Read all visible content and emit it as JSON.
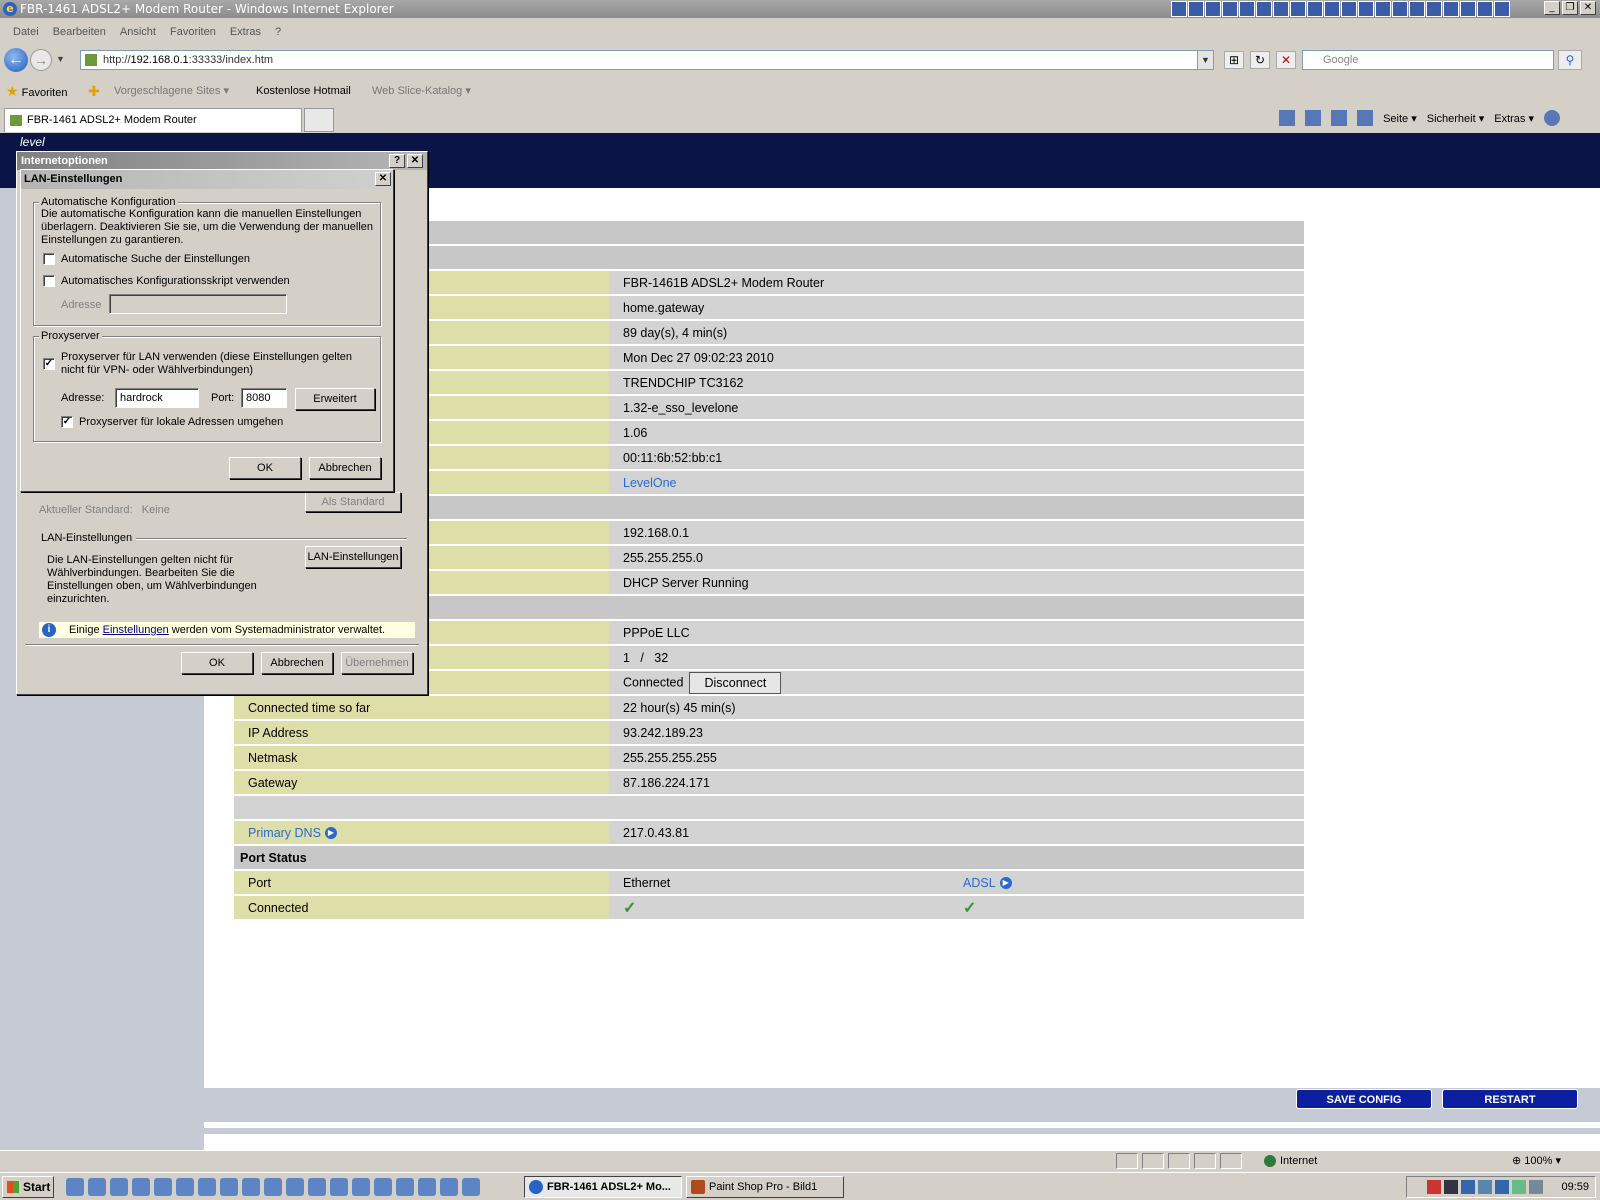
{
  "window": {
    "title": "FBR-1461 ADSL2+ Modem Router - Windows Internet Explorer",
    "controls": [
      "_",
      "❐",
      "✕"
    ]
  },
  "menu": [
    "Datei",
    "Bearbeiten",
    "Ansicht",
    "Favoriten",
    "Extras",
    "?"
  ],
  "address": {
    "prefix": "http://",
    "host": "192.168.0.1",
    "suffix": ":33333/index.htm",
    "search_placeholder": "Google"
  },
  "favorites": {
    "label": "Favoriten",
    "items": [
      "Vorgeschlagene Sites ▾",
      "Kostenlose Hotmail",
      "Web Slice-Katalog ▾"
    ]
  },
  "tab": {
    "label": "FBR-1461 ADSL2+ Modem Router"
  },
  "command_bar": [
    "Seite ▾",
    "Sicherheit ▾",
    "Extras ▾"
  ],
  "router": {
    "logo": "level",
    "device": [
      "FBR-1461B ADSL2+ Modem Router",
      "home.gateway",
      "89 day(s), 4 min(s)",
      "Mon Dec 27 09:02:23 2010",
      "TRENDCHIP TC3162",
      "1.32-e_sso_levelone",
      "1.06",
      "00:11:6b:52:bb:c1",
      "LevelOne"
    ],
    "lan": [
      "192.168.0.1",
      "255.255.255.0",
      "DHCP Server Running"
    ],
    "wan_mode": "PPPoE LLC",
    "vpi_vci": "1   /   32",
    "status": "Connected",
    "disconnect_label": "Disconnect",
    "wan_rows": [
      {
        "label": "Connected time so far",
        "value": "22 hour(s) 45 min(s)"
      },
      {
        "label": "IP Address",
        "value": "93.242.189.23"
      },
      {
        "label": "Netmask",
        "value": "255.255.255.255"
      },
      {
        "label": "Gateway",
        "value": "87.186.224.171"
      }
    ],
    "dns_label": "Primary DNS",
    "dns_value": "217.0.43.81",
    "port_section": "Port Status",
    "port_label": "Port",
    "port_eth": "Ethernet",
    "port_adsl": "ADSL",
    "connected_label": "Connected",
    "check_eth": "✓",
    "check_adsl": "✓",
    "save_label": "SAVE CONFIG",
    "restart_label": "RESTART"
  },
  "dialog_outer": {
    "title": "Internetoptionen",
    "help": "?",
    "close": "✕",
    "std_label": "Aktueller Standard:",
    "std_value": "Keine",
    "std_button": "Als Standard",
    "lan_group": "LAN-Einstellungen",
    "lan_desc": "Die LAN-Einstellungen gelten nicht für Wählverbindungen. Bearbeiten Sie die Einstellungen oben, um Wählverbindungen einzurichten.",
    "lan_button": "LAN-Einstellungen",
    "info_pre": "Einige",
    "info_link": "Einstellungen",
    "info_post": "werden vom Systemadministrator verwaltet.",
    "ok": "OK",
    "cancel": "Abbrechen",
    "apply": "Übernehmen"
  },
  "dialog_lan": {
    "title": "LAN-Einstellungen",
    "close": "✕",
    "auto_legend": "Automatische Konfiguration",
    "auto_desc": "Die automatische Konfiguration kann die manuellen Einstellungen überlagern. Deaktivieren Sie sie, um die Verwendung der manuellen Einstellungen zu garantieren.",
    "auto_detect": "Automatische Suche der Einstellungen",
    "auto_script": "Automatisches Konfigurationsskript verwenden",
    "script_address_label": "Adresse",
    "proxy_legend": "Proxyserver",
    "proxy_use": "Proxyserver für LAN verwenden (diese Einstellungen gelten nicht für VPN- oder Wählverbindungen)",
    "address_label": "Adresse:",
    "address_value": "hardrock",
    "port_label": "Port:",
    "port_value": "8080",
    "advanced": "Erweitert",
    "bypass_local": "Proxyserver für lokale Adressen umgehen",
    "check": "✓",
    "ok": "OK",
    "cancel": "Abbrechen"
  },
  "status_bar": {
    "zone": "Internet",
    "zoom": "100%"
  },
  "taskbar": {
    "start": "Start",
    "tasks": [
      "FBR-1461 ADSL2+ Mo...",
      "Paint Shop Pro - Bild1"
    ],
    "clock": "09:59"
  }
}
